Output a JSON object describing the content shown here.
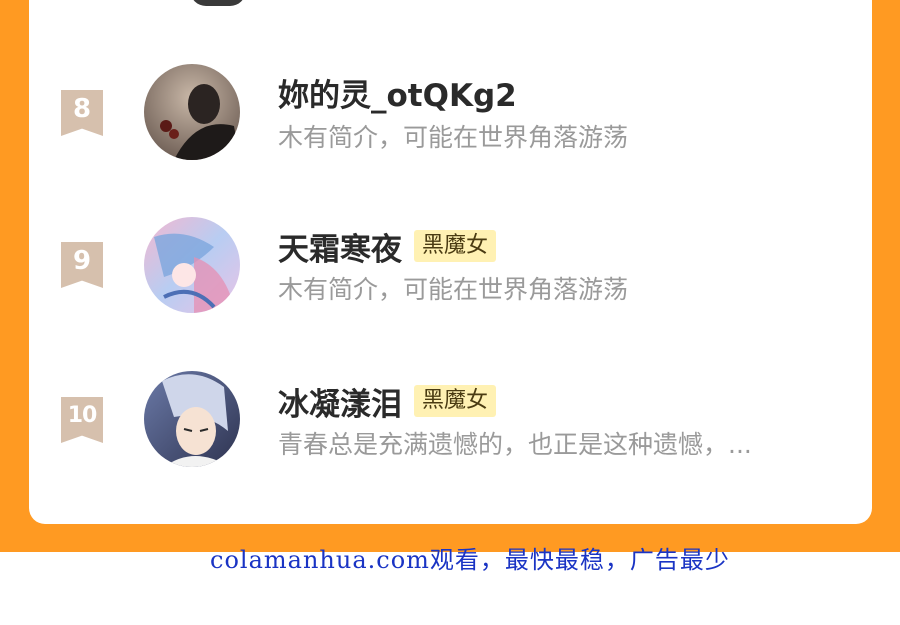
{
  "users": [
    {
      "rank": "8",
      "name": "妳的灵_otQKg2",
      "tag": "",
      "bio": "木有简介，可能在世界角落游荡",
      "avatar": "user-avatar-dark-photo"
    },
    {
      "rank": "9",
      "name": "天霜寒夜",
      "tag": "黑魔女",
      "bio": "木有简介，可能在世界角落游荡",
      "avatar": "user-avatar-anime-pastel"
    },
    {
      "rank": "10",
      "name": "冰凝漾泪",
      "tag": "黑魔女",
      "bio": "青春总是充满遗憾的，也正是这种遗憾，...",
      "avatar": "user-avatar-anime-boy"
    }
  ],
  "footer": {
    "text": "colamanhua.com观看，最快最稳，广告最少"
  },
  "colors": {
    "frame": "#ff9a22",
    "badge": "#d6c0ad",
    "tag_bg": "#fff1b3",
    "footer_text": "#1a34c4"
  }
}
